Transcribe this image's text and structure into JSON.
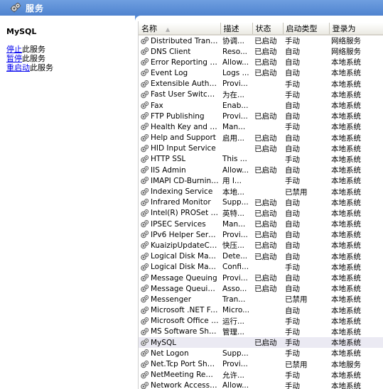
{
  "header": {
    "title": "服务"
  },
  "left_panel": {
    "service_name": "MySQL",
    "actions": [
      {
        "link": "停止",
        "suffix": "此服务"
      },
      {
        "link": "暂停",
        "suffix": "此服务"
      },
      {
        "link": "重启动",
        "suffix": "此服务"
      }
    ]
  },
  "columns": [
    "名称",
    "描述",
    "状态",
    "启动类型",
    "登录为"
  ],
  "rows": [
    {
      "name": "Distributed Transac...",
      "desc": "协调...",
      "status": "已启动",
      "startup": "手动",
      "logon": "网络服务"
    },
    {
      "name": "DNS Client",
      "desc": "Reso...",
      "status": "已启动",
      "startup": "自动",
      "logon": "网络服务"
    },
    {
      "name": "Error Reporting Ser...",
      "desc": "Allow...",
      "status": "已启动",
      "startup": "自动",
      "logon": "本地系统"
    },
    {
      "name": "Event Log",
      "desc": "Logs ...",
      "status": "已启动",
      "startup": "自动",
      "logon": "本地系统"
    },
    {
      "name": "Extensible Authenti...",
      "desc": "Provi...",
      "status": "",
      "startup": "手动",
      "logon": "本地系统"
    },
    {
      "name": "Fast User Switching...",
      "desc": "为在...",
      "status": "",
      "startup": "手动",
      "logon": "本地系统"
    },
    {
      "name": "Fax",
      "desc": "Enab...",
      "status": "",
      "startup": "自动",
      "logon": "本地系统"
    },
    {
      "name": "FTP Publishing",
      "desc": "Provi...",
      "status": "已启动",
      "startup": "自动",
      "logon": "本地系统"
    },
    {
      "name": "Health Key and Cer...",
      "desc": "Man...",
      "status": "",
      "startup": "手动",
      "logon": "本地系统"
    },
    {
      "name": "Help and Support",
      "desc": "启用...",
      "status": "已启动",
      "startup": "自动",
      "logon": "本地系统"
    },
    {
      "name": "HID Input Service",
      "desc": "",
      "status": "已启动",
      "startup": "自动",
      "logon": "本地系统"
    },
    {
      "name": "HTTP SSL",
      "desc": "This ...",
      "status": "",
      "startup": "手动",
      "logon": "本地系统"
    },
    {
      "name": "IIS Admin",
      "desc": "Allow...",
      "status": "已启动",
      "startup": "自动",
      "logon": "本地系统"
    },
    {
      "name": "IMAPI CD-Burning ...",
      "desc": "用 I...",
      "status": "",
      "startup": "手动",
      "logon": "本地系统"
    },
    {
      "name": "Indexing Service",
      "desc": "本地...",
      "status": "",
      "startup": "已禁用",
      "logon": "本地系统"
    },
    {
      "name": "Infrared Monitor",
      "desc": "Supp...",
      "status": "已启动",
      "startup": "自动",
      "logon": "本地系统"
    },
    {
      "name": "Intel(R) PROSet Mo...",
      "desc": "英特...",
      "status": "已启动",
      "startup": "自动",
      "logon": "本地系统"
    },
    {
      "name": "IPSEC Services",
      "desc": "Man...",
      "status": "已启动",
      "startup": "自动",
      "logon": "本地系统"
    },
    {
      "name": "IPv6 Helper Service",
      "desc": "Provi...",
      "status": "已启动",
      "startup": "自动",
      "logon": "本地系统"
    },
    {
      "name": "KuaizipUpdateChec...",
      "desc": "快压...",
      "status": "已启动",
      "startup": "自动",
      "logon": "本地系统"
    },
    {
      "name": "Logical Disk Manager",
      "desc": "Dete...",
      "status": "已启动",
      "startup": "自动",
      "logon": "本地系统"
    },
    {
      "name": "Logical Disk Manag...",
      "desc": "Confi...",
      "status": "",
      "startup": "手动",
      "logon": "本地系统"
    },
    {
      "name": "Message Queuing",
      "desc": "Provi...",
      "status": "已启动",
      "startup": "自动",
      "logon": "本地系统"
    },
    {
      "name": "Message Queuing T...",
      "desc": "Asso...",
      "status": "已启动",
      "startup": "自动",
      "logon": "本地系统"
    },
    {
      "name": "Messenger",
      "desc": "Tran...",
      "status": "",
      "startup": "已禁用",
      "logon": "本地系统"
    },
    {
      "name": "Microsoft .NET Fra...",
      "desc": "Micro...",
      "status": "",
      "startup": "自动",
      "logon": "本地系统"
    },
    {
      "name": "Microsoft Office Dia...",
      "desc": "运行...",
      "status": "",
      "startup": "手动",
      "logon": "本地系统"
    },
    {
      "name": "MS Software Shado...",
      "desc": "管理...",
      "status": "",
      "startup": "手动",
      "logon": "本地系统"
    },
    {
      "name": "MySQL",
      "desc": "",
      "status": "已启动",
      "startup": "手动",
      "logon": "本地系统",
      "selected": true
    },
    {
      "name": "Net Logon",
      "desc": "Supp...",
      "status": "",
      "startup": "手动",
      "logon": "本地系统"
    },
    {
      "name": "Net.Tcp Port Sharin...",
      "desc": "Provi...",
      "status": "",
      "startup": "已禁用",
      "logon": "本地服务"
    },
    {
      "name": "NetMeeting Remot...",
      "desc": "允许...",
      "status": "",
      "startup": "手动",
      "logon": "本地系统"
    },
    {
      "name": "Network Access Pr...",
      "desc": "Allow...",
      "status": "",
      "startup": "手动",
      "logon": "本地系统"
    }
  ]
}
